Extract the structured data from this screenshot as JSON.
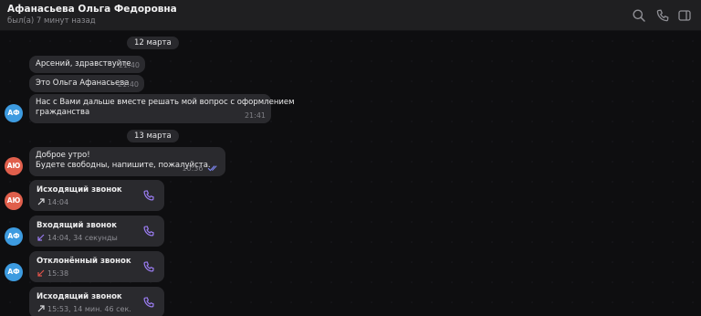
{
  "colors": {
    "background": "#0e0e10",
    "header": "#1f1f21",
    "bubble": "#2a2a2e",
    "accent_purple": "#9a7cf0",
    "avatar_af": "#3d9be0",
    "avatar_ayu": "#e05f4c",
    "missed_red": "#e0534a",
    "read_check": "#7d86f0"
  },
  "header": {
    "title": "Афанасьева Ольга Федоровна",
    "status": "был(а) 7 минут назад",
    "icons": [
      "search-icon",
      "phone-icon",
      "sidebar-toggle-icon"
    ]
  },
  "dates": [
    "12 марта",
    "13 марта"
  ],
  "messages": [
    {
      "text": "Арсений, здравствуйте",
      "time": "21:40"
    },
    {
      "text": "Это Ольга Афанасьева",
      "time": "21:40"
    },
    {
      "lines": [
        "Нас с Вами дальше вместе решать мой вопрос с оформлением",
        "гражданства"
      ],
      "time": "21:41",
      "avatar": "АФ"
    },
    {
      "lines": [
        "Доброе утро!",
        "Будете свободны, напишите, пожалуйста."
      ],
      "time": "10:36",
      "avatar": "АЮ",
      "read": true
    }
  ],
  "calls": [
    {
      "title": "Исходящий звонок",
      "meta": "14:04",
      "direction": "outgoing",
      "avatar": "АЮ"
    },
    {
      "title": "Входящий звонок",
      "meta": "14:04, 34 секунды",
      "direction": "incoming",
      "avatar": "АФ"
    },
    {
      "title": "Отклонённый звонок",
      "meta": "15:38",
      "direction": "declined",
      "avatar": "АФ"
    },
    {
      "title": "Исходящий звонок",
      "meta": "15:53, 14 мин. 46 сек.",
      "direction": "outgoing",
      "avatar": ""
    }
  ]
}
